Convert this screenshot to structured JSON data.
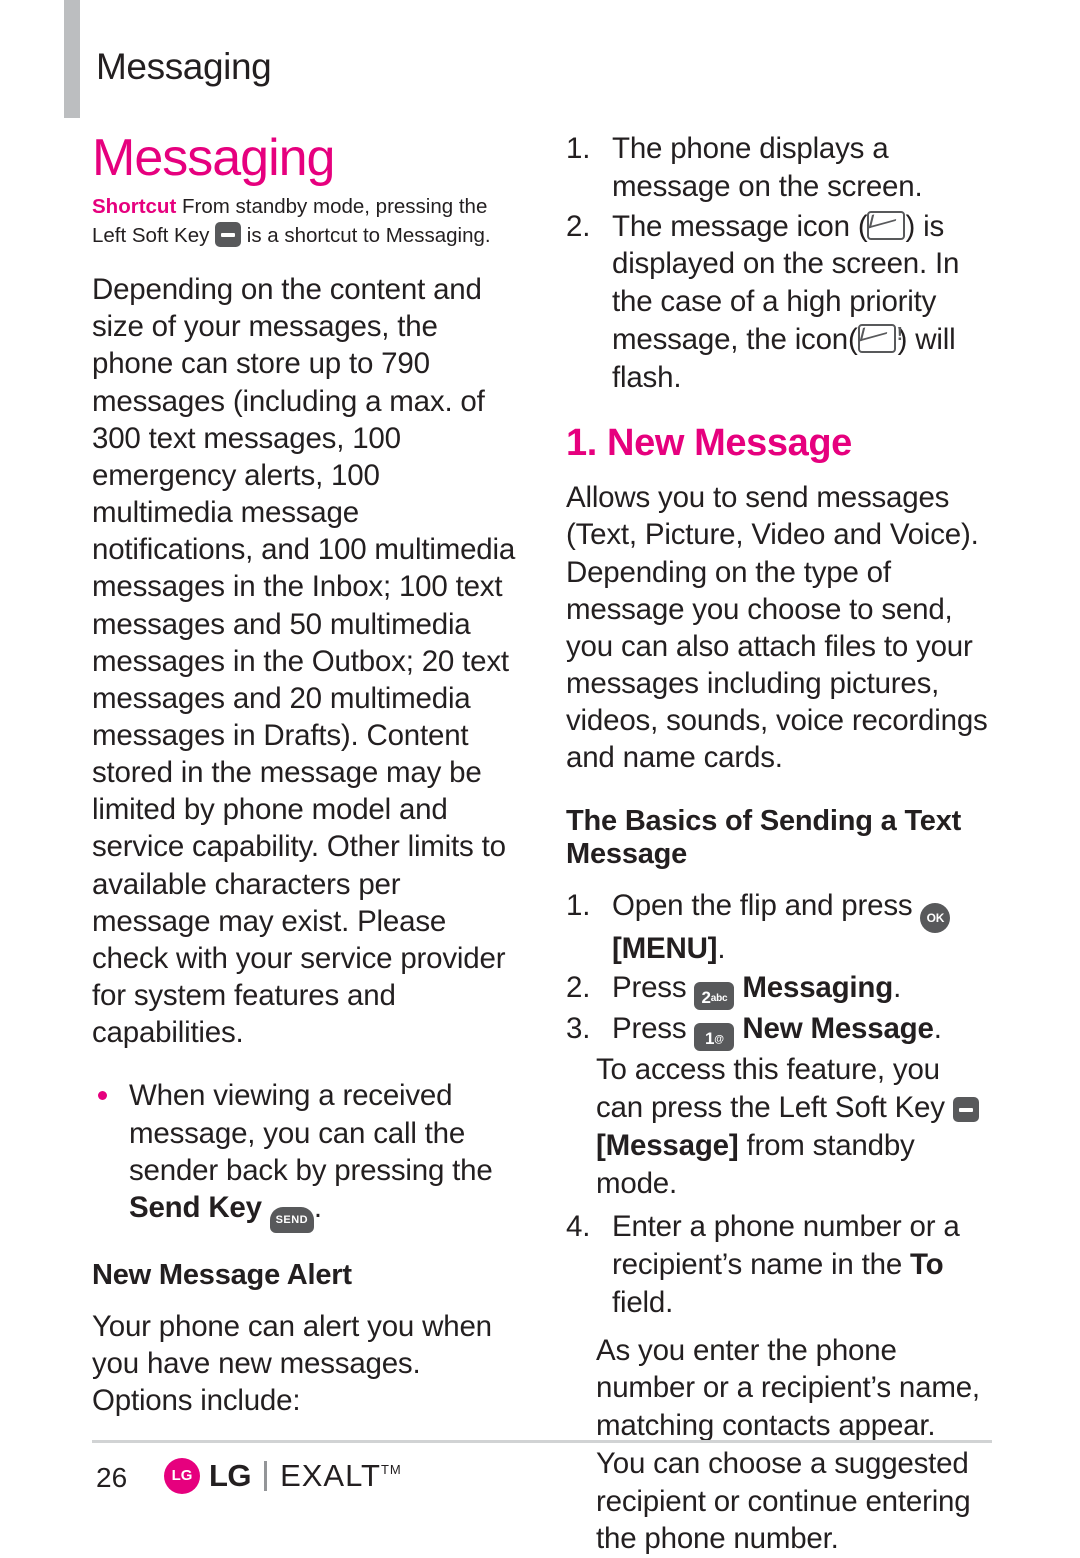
{
  "running_head": "Messaging",
  "chapter_title": "Messaging",
  "shortcut": {
    "label": "Shortcut",
    "text_before_key": " From standby mode, pressing the Left Soft Key ",
    "text_after_key": " is a shortcut to Messaging."
  },
  "left_column": {
    "intro_paragraph": "Depending on the content and size of your messages, the phone can store up to 790 messages (including a max. of 300 text messages, 100 emergency alerts, 100 multimedia message notifications, and 100 multimedia messages in the Inbox; 100 text messages and 50 multimedia messages in the Outbox; 20 text messages and 20 multimedia messages in Drafts). Content stored in the message may be limited by phone model and service capability. Other limits to available characters per message may exist. Please check with your service provider for system features and capabilities.",
    "bullet_1_text": "When viewing a received message, you can call the sender back by pressing the ",
    "bullet_1_bold": "Send Key",
    "bullet_1_tail": ".",
    "subheading": "New Message Alert",
    "alert_paragraph": "Your phone can alert you when you have new messages. Options include:"
  },
  "right_column": {
    "step_1_num": "1.",
    "step_1_text": "The phone displays a message on the screen.",
    "step_2_num": "2.",
    "step_2_part_a": "The message icon (",
    "step_2_part_b": ") is displayed on the screen. In the case of a high priority message, the icon(",
    "step_2_part_c": ") will flash.",
    "section_title": "1. New Message",
    "allows_paragraph": "Allows you to send messages (Text, Picture, Video and Voice). Depending on the type of message you choose to send, you can also attach files to your messages including pictures, videos, sounds, voice recordings and name cards.",
    "basics_heading": "The Basics of Sending a Text Message",
    "b_step_1_num": "1.",
    "b_step_1_text": "Open the flip and press ",
    "b_step_1_menu": "[MENU]",
    "b_step_1_tail": ".",
    "b_step_2_num": "2.",
    "b_step_2_text": "Press ",
    "b_step_2_bold": "Messaging",
    "b_step_2_tail": ".",
    "b_step_3_num": "3.",
    "b_step_3_text": "Press ",
    "b_step_3_bold": "New Message",
    "b_step_3_tail": ".",
    "access_text_a": "To access this feature, you can press the Left Soft Key ",
    "access_bold": "[Message]",
    "access_text_b": " from standby mode.",
    "b_step_4_num": "4.",
    "b_step_4_text_a": "Enter a phone number or a recipient’s name in the ",
    "b_step_4_bold": "To",
    "b_step_4_text_b": " field.",
    "matching_paragraph": "As you enter the phone number or a recipient’s name, matching contacts appear. You can choose a suggested recipient or continue entering the phone number."
  },
  "keys": {
    "soft_key_icon": "soft-key-icon",
    "send_key_label": "SEND",
    "ok_key_label": "OK",
    "num2_big": "2",
    "num2_sup": "abc",
    "num1_big": "1",
    "num1_sup": "@"
  },
  "footer": {
    "page_number": "26",
    "brand": "LG",
    "model": "EXALT",
    "trademark": "TM"
  },
  "colors": {
    "accent": "#e6007e",
    "text": "#231f20",
    "key_gray": "#58595b",
    "rule": "#d1d3d4",
    "edge_bar": "#bcbec0"
  }
}
